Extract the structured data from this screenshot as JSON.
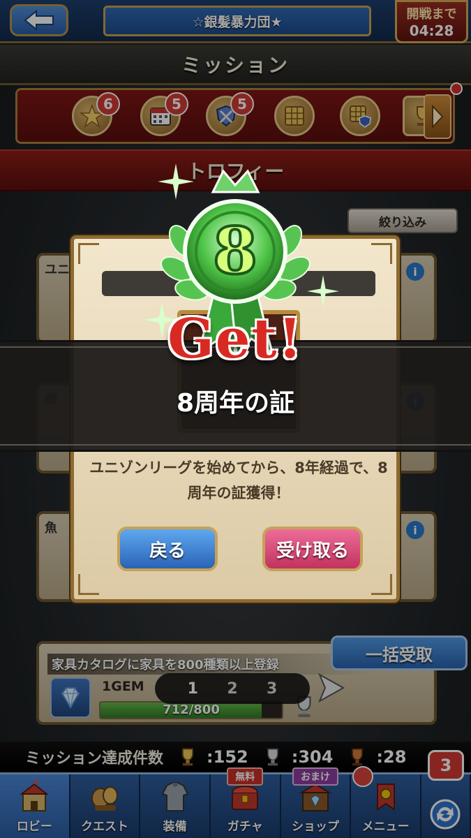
{
  "header": {
    "guild_name": "☆銀髪暴力団★",
    "battle_label": "開戦まで",
    "battle_timer": "04:28"
  },
  "mission": {
    "title": "ミッション",
    "tabs": [
      {
        "icon": "star-icon",
        "badge": "6"
      },
      {
        "icon": "calendar-icon",
        "badge": "5"
      },
      {
        "icon": "shield-swords-icon",
        "badge": "5"
      },
      {
        "icon": "grid-board-icon",
        "badge": ""
      },
      {
        "icon": "board-shield-icon",
        "badge": ""
      },
      {
        "icon": "trophy-icon",
        "badge": ""
      }
    ],
    "section_title": "トロフィー",
    "filter_label": "絞り込み"
  },
  "background_cards": [
    {
      "head": "ユニ"
    },
    {
      "head": "師"
    },
    {
      "head": "魚"
    }
  ],
  "mission_item": {
    "description": "家具カタログに家具を800種類以上登録",
    "reward": "1GEM",
    "progress_text": "712/800",
    "progress_fraction": 0.89
  },
  "pager": {
    "pages": [
      "1",
      "2",
      "3"
    ],
    "current": "1"
  },
  "bulk_receive_label": "一括受取",
  "totals": {
    "label": "ミッション達成件数",
    "gold": ":152",
    "silver": ":304",
    "bronze": ":28"
  },
  "nav": {
    "items": [
      {
        "label": "ロビー",
        "icon": "castle-icon"
      },
      {
        "label": "クエスト",
        "icon": "quest-scroll-icon"
      },
      {
        "label": "装備",
        "icon": "armor-icon"
      },
      {
        "label": "ガチャ",
        "icon": "gacha-chest-icon",
        "tag": "無料"
      },
      {
        "label": "ショップ",
        "icon": "shop-icon",
        "tag": "おまけ"
      },
      {
        "label": "メニュー",
        "icon": "menu-icon"
      }
    ],
    "sync_badge": "3"
  },
  "dialog": {
    "medal_number": "8",
    "get_text": "Get!",
    "award_name": "8周年の証",
    "description": "ユニゾンリーグを始めてから、8年経過で、8周年の証獲得！",
    "back_label": "戻る",
    "receive_label": "受け取る"
  },
  "colors": {
    "accent_blue": "#2a63b6",
    "accent_pink": "#c2325f",
    "medal_green": "#3fb33a",
    "get_red": "#d82a23"
  }
}
